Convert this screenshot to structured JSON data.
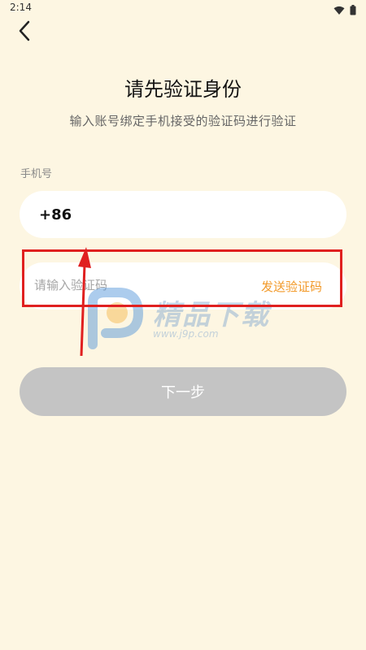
{
  "status_bar": {
    "time": "2:14"
  },
  "header": {
    "title": "请先验证身份",
    "subtitle": "输入账号绑定手机接受的验证码进行验证"
  },
  "form": {
    "phone_label": "手机号",
    "phone_prefix": "+86",
    "code_placeholder": "请输入验证码",
    "send_code_label": "发送验证码",
    "next_label": "下一步"
  },
  "watermark": {
    "text": "精品下载",
    "url": "www.j9p.com"
  },
  "colors": {
    "background": "#fdf6e2",
    "accent": "#f29a2a",
    "disabled_button": "#c4c4c4",
    "annotation": "#e02020"
  },
  "icons": {
    "back": "back-arrow-icon",
    "wifi": "wifi-icon",
    "battery": "battery-icon"
  }
}
